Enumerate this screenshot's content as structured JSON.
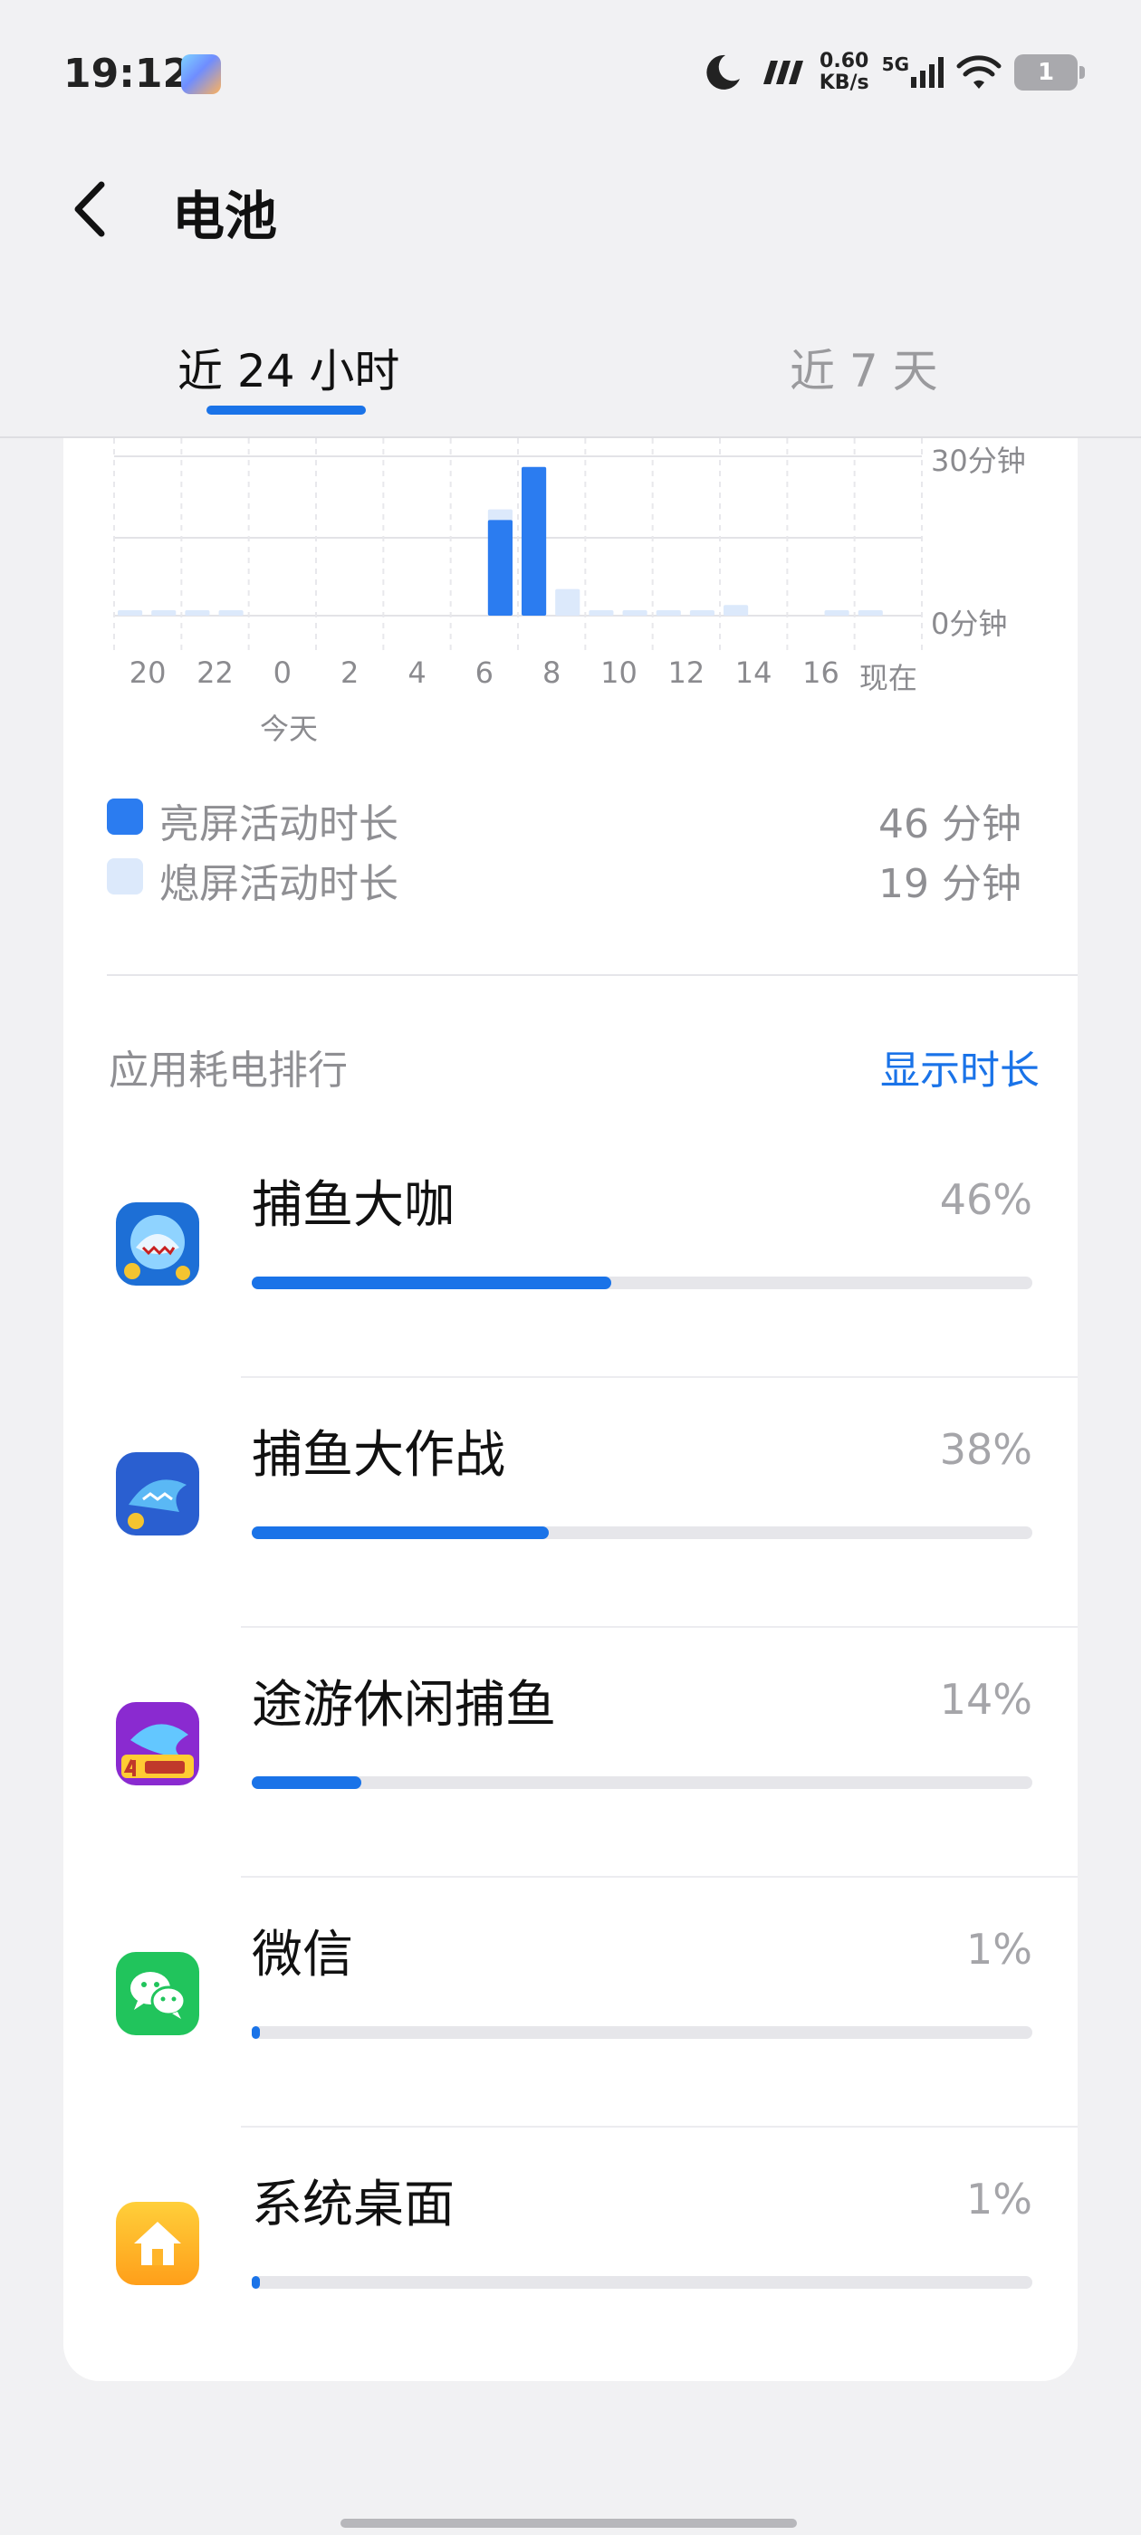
{
  "status_bar": {
    "time": "19:12",
    "speed_value": "0.60",
    "speed_unit": "KB/s",
    "network": "5G",
    "battery_level": "1"
  },
  "header": {
    "title": "电池"
  },
  "tabs": [
    {
      "label": "近 24 小时",
      "selected": true
    },
    {
      "label": "近 7 天",
      "selected": false
    }
  ],
  "chart_data": {
    "type": "bar",
    "y_tick_labels": [
      "30分钟",
      "0分钟"
    ],
    "ylim": [
      0,
      30
    ],
    "x_tick_labels": [
      "20",
      "22",
      "0",
      "2",
      "4",
      "6",
      "8",
      "10",
      "12",
      "14",
      "16",
      "现在"
    ],
    "x_sublabel": "今天",
    "grid": true,
    "colors": {
      "screen_on": "#2b7cf0",
      "screen_off": "#dce9fb"
    },
    "screen_on_minutes": [
      0,
      0,
      0,
      0,
      0,
      0,
      0,
      0,
      0,
      0,
      0,
      0,
      0,
      0,
      0,
      0,
      0,
      0,
      0,
      0,
      0,
      0,
      0,
      0,
      0,
      0,
      0,
      0,
      0,
      0,
      0,
      0,
      0,
      0,
      0,
      0,
      0,
      0,
      0,
      0,
      0,
      0,
      0,
      0,
      0,
      0,
      0,
      0
    ],
    "series": [
      {
        "name": "亮屏活动时长",
        "values": [
          0,
          0,
          0,
          0,
          0,
          0,
          0,
          0,
          0,
          0,
          0,
          18,
          28,
          0,
          0,
          0,
          0,
          0,
          0,
          0,
          0,
          0,
          0,
          0
        ]
      },
      {
        "name": "熄屏活动时长",
        "values": [
          1,
          1,
          1,
          1,
          0,
          0,
          0,
          0,
          0,
          0,
          0,
          20,
          0,
          5,
          1,
          1,
          1,
          1,
          2,
          0,
          0,
          1,
          1,
          0
        ]
      }
    ]
  },
  "legend": [
    {
      "label": "亮屏活动时长",
      "value": "46 分钟",
      "color": "#2b7cf0"
    },
    {
      "label": "熄屏活动时长",
      "value": "19 分钟",
      "color": "#dce9fb"
    }
  ],
  "ranking": {
    "title": "应用耗电排行",
    "action": "显示时长",
    "apps": [
      {
        "name": "捕鱼大咖",
        "percent": "46%",
        "fraction": 0.46,
        "icon": "fishing-game-icon"
      },
      {
        "name": "捕鱼大作战",
        "percent": "38%",
        "fraction": 0.38,
        "icon": "fishing-battle-icon"
      },
      {
        "name": "途游休闲捕鱼",
        "percent": "14%",
        "fraction": 0.14,
        "icon": "tuyou-fishing-icon"
      },
      {
        "name": "微信",
        "percent": "1%",
        "fraction": 0.01,
        "icon": "wechat-icon"
      },
      {
        "name": "系统桌面",
        "percent": "1%",
        "fraction": 0.01,
        "icon": "home-launcher-icon"
      }
    ]
  }
}
